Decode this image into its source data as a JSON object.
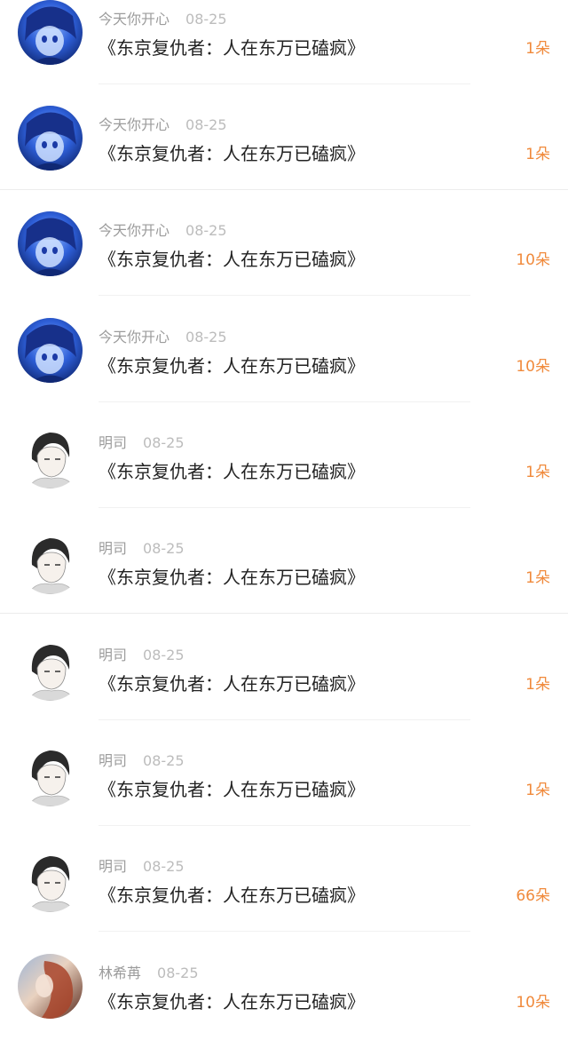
{
  "colors": {
    "amount": "#f08a3c",
    "title": "#222222",
    "meta": "#b1b1b1"
  },
  "rows": [
    {
      "avatar": "anime-blue-avatar",
      "name": "今天你开心",
      "date": "08-25",
      "title": "《东京复仇者：人在东万已磕疯》",
      "amount": "1朵"
    },
    {
      "avatar": "anime-blue-avatar",
      "name": "今天你开心",
      "date": "08-25",
      "title": "《东京复仇者：人在东万已磕疯》",
      "amount": "1朵"
    },
    {
      "avatar": "anime-blue-avatar",
      "name": "今天你开心",
      "date": "08-25",
      "title": "《东京复仇者：人在东万已磕疯》",
      "amount": "10朵"
    },
    {
      "avatar": "anime-blue-avatar",
      "name": "今天你开心",
      "date": "08-25",
      "title": "《东京复仇者：人在东万已磕疯》",
      "amount": "10朵"
    },
    {
      "avatar": "sketch-boy-avatar",
      "name": "明司",
      "date": "08-25",
      "title": "《东京复仇者：人在东万已磕疯》",
      "amount": "1朵"
    },
    {
      "avatar": "sketch-boy-avatar",
      "name": "明司",
      "date": "08-25",
      "title": "《东京复仇者：人在东万已磕疯》",
      "amount": "1朵"
    },
    {
      "avatar": "sketch-boy-avatar",
      "name": "明司",
      "date": "08-25",
      "title": "《东京复仇者：人在东万已磕疯》",
      "amount": "1朵"
    },
    {
      "avatar": "sketch-boy-avatar",
      "name": "明司",
      "date": "08-25",
      "title": "《东京复仇者：人在东万已磕疯》",
      "amount": "1朵"
    },
    {
      "avatar": "sketch-boy-avatar",
      "name": "明司",
      "date": "08-25",
      "title": "《东京复仇者：人在东万已磕疯》",
      "amount": "66朵"
    },
    {
      "avatar": "painted-portrait-avatar",
      "name": "林希苒",
      "date": "08-25",
      "title": "《东京复仇者：人在东万已磕疯》",
      "amount": "10朵"
    }
  ]
}
